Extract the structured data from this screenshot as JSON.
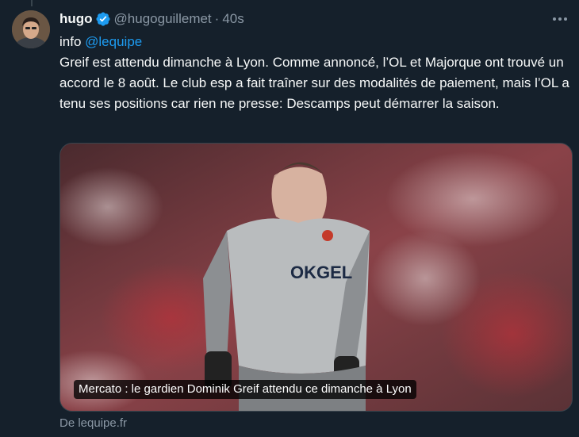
{
  "tweet": {
    "display_name": "hugo",
    "handle": "@hugoguillemet",
    "separator": "·",
    "timestamp": "40s",
    "intro": "info ",
    "mention": "@lequipe",
    "text": "Greif est attendu dimanche à Lyon. Comme annoncé, l’OL et Majorque ont trouvé un accord le 8 août. Le club esp a fait traîner sur des modalités de paiement, mais l’OL a tenu ses positions car rien ne presse: Descamps peut démarrer la saison.",
    "card_caption": "Mercato : le gardien Dominik Greif attendu ce dimanche à Lyon",
    "card_source": "De lequipe.fr",
    "jersey_sponsor": "OKGEL"
  },
  "colors": {
    "background": "#15202b",
    "text_primary": "#f7f9f9",
    "text_secondary": "#8b98a5",
    "link": "#1d9bf0",
    "verified": "#1d9bf0",
    "border": "#38444d"
  },
  "icons": {
    "verified": "verified-badge-icon",
    "more": "more-horizontal-icon"
  }
}
